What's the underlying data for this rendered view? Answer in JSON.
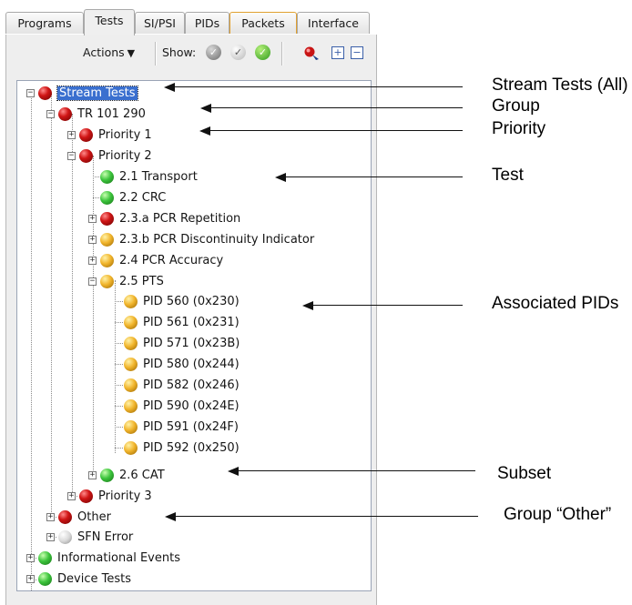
{
  "tabs": [
    {
      "label": "Programs",
      "active": false
    },
    {
      "label": "Tests",
      "active": true
    },
    {
      "label": "SI/PSI",
      "active": false
    },
    {
      "label": "PIDs",
      "active": false
    },
    {
      "label": "Packets",
      "active": false
    },
    {
      "label": "Interface",
      "active": false
    }
  ],
  "toolbar": {
    "actions_label": "Actions",
    "show_label": "Show:",
    "show_icons": [
      "grey-check-icon",
      "white-check-icon",
      "green-check-icon"
    ],
    "filter_icon": "pin-filter-icon",
    "expand_all_icon": "expand-all-icon",
    "collapse_all_icon": "collapse-all-icon"
  },
  "tree": {
    "stream_tests": "Stream Tests",
    "tr101290": "TR 101 290",
    "priority1": "Priority 1",
    "priority2": "Priority 2",
    "t21": "2.1 Transport",
    "t22": "2.2 CRC",
    "t23a": "2.3.a PCR Repetition",
    "t23b": "2.3.b PCR Discontinuity Indicator",
    "t24": "2.4 PCR Accuracy",
    "t25": "2.5 PTS",
    "pids": [
      "PID 560 (0x230)",
      "PID 561 (0x231)",
      "PID 571 (0x23B)",
      "PID 580 (0x244)",
      "PID 582 (0x246)",
      "PID 590 (0x24E)",
      "PID 591 (0x24F)",
      "PID 592 (0x250)"
    ],
    "t26": "2.6 CAT",
    "priority3": "Priority 3",
    "other": "Other",
    "sfn_error": "SFN Error",
    "informational": "Informational Events",
    "device_tests": "Device Tests"
  },
  "status_colors": {
    "error": "#d01515",
    "ok": "#3cc43c",
    "warning": "#f1b52c",
    "inactive": "#d9d9d9",
    "selection": "#3a6fcf"
  },
  "callouts": {
    "stream_tests_all": "Stream Tests (All)",
    "group": "Group",
    "priority": "Priority",
    "test": "Test",
    "associated_pids": "Associated PIDs",
    "subset": "Subset",
    "group_other": "Group “Other”"
  }
}
